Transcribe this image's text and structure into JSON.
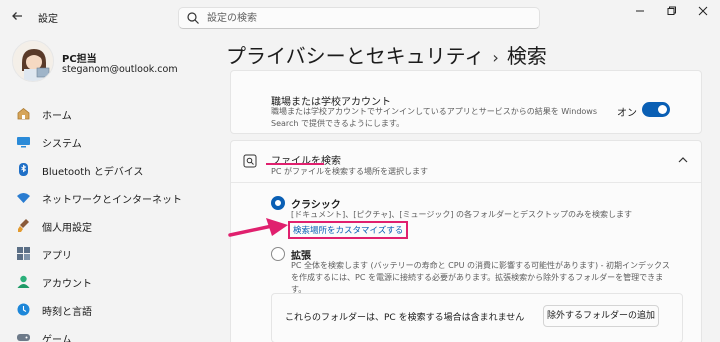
{
  "titlebar": {
    "app_title": "設定",
    "search_placeholder": "設定の検索"
  },
  "profile": {
    "name": "PC担当",
    "email": "steganom@outlook.com"
  },
  "sidebar": {
    "items": [
      {
        "label": "ホーム",
        "icon": "home-icon"
      },
      {
        "label": "システム",
        "icon": "system-icon"
      },
      {
        "label": "Bluetooth とデバイス",
        "icon": "bluetooth-icon"
      },
      {
        "label": "ネットワークとインターネット",
        "icon": "wifi-icon"
      },
      {
        "label": "個人用設定",
        "icon": "brush-icon"
      },
      {
        "label": "アプリ",
        "icon": "apps-icon"
      },
      {
        "label": "アカウント",
        "icon": "account-icon"
      },
      {
        "label": "時刻と言語",
        "icon": "globe-clock-icon"
      },
      {
        "label": "ゲーム",
        "icon": "game-icon"
      }
    ]
  },
  "breadcrumb": {
    "parent": "プライバシーとセキュリティ",
    "separator": "›",
    "current": "検索"
  },
  "work_account": {
    "title": "職場または学校アカウント",
    "description": "職場または学校アカウントでサインインしているアプリとサービスからの結果を Windows Search で提供できるようにします。",
    "toggle_label": "オン",
    "toggle_on": true
  },
  "find_files": {
    "title": "ファイルを検索",
    "subtitle": "PC がファイルを検索する場所を選択します",
    "chevron": "^",
    "classic": {
      "label": "クラシック",
      "description": "[ドキュメント]、[ピクチャ]、[ミュージック] の各フォルダーとデスクトップのみを検索します",
      "link": "検索場所をカスタマイズする",
      "selected": true
    },
    "enhanced": {
      "label": "拡張",
      "description": "PC 全体を検索します (バッテリーの寿命と CPU の消費に影響する可能性があります) - 初期インデックスを作成するには、PC を電源に接続する必要があります。拡張検索から除外するフォルダーを管理できます。",
      "selected": false
    },
    "exclude_text": "これらのフォルダーは、PC を検索する場合は含まれません",
    "exclude_button": "除外するフォルダーの追加"
  },
  "colors": {
    "accent": "#0a5fb4",
    "highlight": "#e0206e"
  }
}
